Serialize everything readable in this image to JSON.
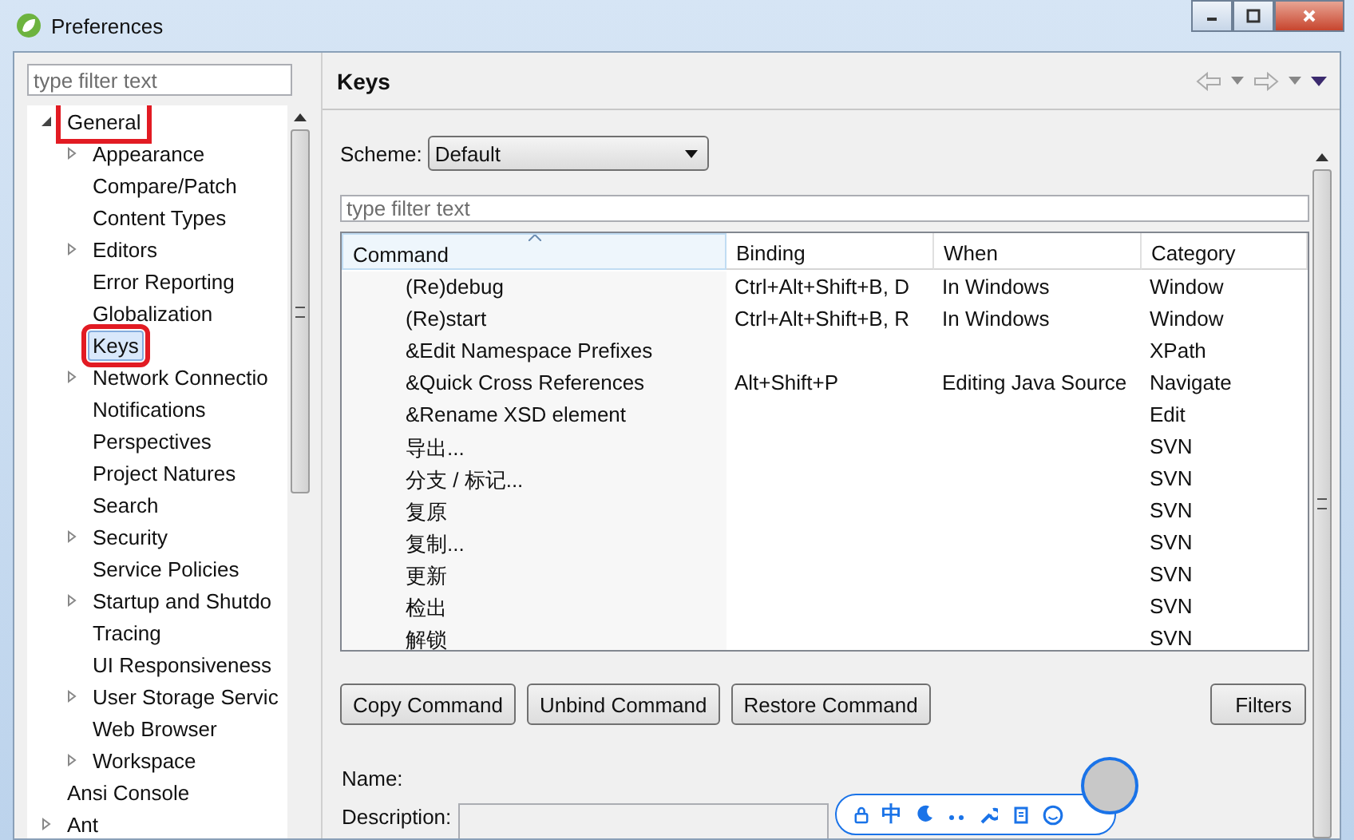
{
  "window": {
    "title": "Preferences"
  },
  "sidebar": {
    "filter_placeholder": "type filter text",
    "tree": [
      {
        "label": "General",
        "kind": "branch",
        "expanded": true,
        "selected": false,
        "highlighted": true,
        "children": [
          {
            "label": "Appearance",
            "kind": "branch",
            "expanded": false,
            "selected": false,
            "highlighted": false
          },
          {
            "label": "Compare/Patch",
            "kind": "leaf",
            "selected": false,
            "highlighted": false
          },
          {
            "label": "Content Types",
            "kind": "leaf",
            "selected": false,
            "highlighted": false
          },
          {
            "label": "Editors",
            "kind": "branch",
            "expanded": false,
            "selected": false,
            "highlighted": false
          },
          {
            "label": "Error Reporting",
            "kind": "leaf",
            "selected": false,
            "highlighted": false
          },
          {
            "label": "Globalization",
            "kind": "leaf",
            "selected": false,
            "highlighted": false
          },
          {
            "label": "Keys",
            "kind": "leaf",
            "selected": true,
            "highlighted": true
          },
          {
            "label": "Network Connectio",
            "kind": "branch",
            "expanded": false,
            "selected": false,
            "highlighted": false
          },
          {
            "label": "Notifications",
            "kind": "leaf",
            "selected": false,
            "highlighted": false
          },
          {
            "label": "Perspectives",
            "kind": "leaf",
            "selected": false,
            "highlighted": false
          },
          {
            "label": "Project Natures",
            "kind": "leaf",
            "selected": false,
            "highlighted": false
          },
          {
            "label": "Search",
            "kind": "leaf",
            "selected": false,
            "highlighted": false
          },
          {
            "label": "Security",
            "kind": "branch",
            "expanded": false,
            "selected": false,
            "highlighted": false
          },
          {
            "label": "Service Policies",
            "kind": "leaf",
            "selected": false,
            "highlighted": false
          },
          {
            "label": "Startup and Shutdo",
            "kind": "branch",
            "expanded": false,
            "selected": false,
            "highlighted": false
          },
          {
            "label": "Tracing",
            "kind": "leaf",
            "selected": false,
            "highlighted": false
          },
          {
            "label": "UI Responsiveness",
            "kind": "leaf",
            "selected": false,
            "highlighted": false
          },
          {
            "label": "User Storage Servic",
            "kind": "branch",
            "expanded": false,
            "selected": false,
            "highlighted": false
          },
          {
            "label": "Web Browser",
            "kind": "leaf",
            "selected": false,
            "highlighted": false
          },
          {
            "label": "Workspace",
            "kind": "branch",
            "expanded": false,
            "selected": false,
            "highlighted": false
          }
        ]
      },
      {
        "label": "Ansi Console",
        "kind": "leaf",
        "selected": false,
        "highlighted": false
      },
      {
        "label": "Ant",
        "kind": "branch",
        "expanded": false,
        "selected": false,
        "highlighted": false
      }
    ]
  },
  "page": {
    "title": "Keys",
    "scheme_label": "Scheme:",
    "scheme_value": "Default",
    "filter_placeholder": "type filter text",
    "table": {
      "columns": [
        {
          "label": "Command",
          "sorted": true
        },
        {
          "label": "Binding",
          "sorted": false
        },
        {
          "label": "When",
          "sorted": false
        },
        {
          "label": "Category",
          "sorted": false
        }
      ],
      "rows": [
        [
          "(Re)debug",
          "Ctrl+Alt+Shift+B, D",
          "In Windows",
          "Window"
        ],
        [
          "(Re)start",
          "Ctrl+Alt+Shift+B, R",
          "In Windows",
          "Window"
        ],
        [
          "&Edit Namespace Prefixes",
          "",
          "",
          "XPath"
        ],
        [
          "&Quick Cross References",
          "Alt+Shift+P",
          "Editing Java Source",
          "Navigate"
        ],
        [
          "&Rename XSD element",
          "",
          "",
          "Edit"
        ],
        [
          "导出...",
          "",
          "",
          "SVN"
        ],
        [
          "分支 / 标记...",
          "",
          "",
          "SVN"
        ],
        [
          "复原",
          "",
          "",
          "SVN"
        ],
        [
          "复制...",
          "",
          "",
          "SVN"
        ],
        [
          "更新",
          "",
          "",
          "SVN"
        ],
        [
          "检出",
          "",
          "",
          "SVN"
        ],
        [
          "解锁",
          "",
          "",
          "SVN"
        ]
      ]
    },
    "buttons": [
      "Copy Command",
      "Unbind Command",
      "Restore Command"
    ],
    "filters_button": "Filters",
    "name_label": "Name:",
    "description_label": "Description:"
  },
  "ime_bar": {
    "mode": "中"
  }
}
